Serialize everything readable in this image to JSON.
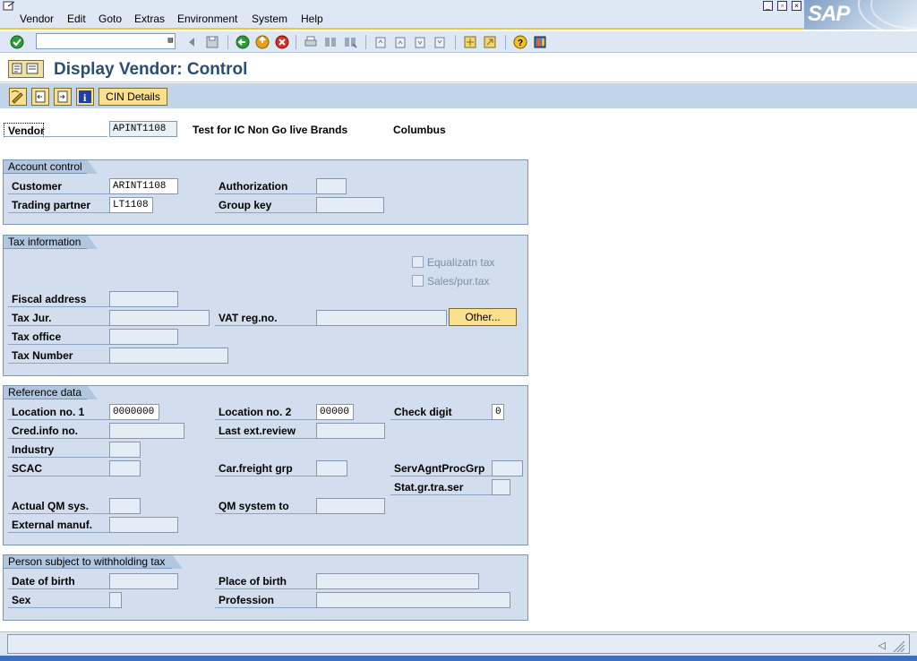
{
  "menubar": {
    "items": [
      "Vendor",
      "Edit",
      "Goto",
      "Extras",
      "Environment",
      "System",
      "Help"
    ],
    "logo_text": "SAP"
  },
  "toolbar": {
    "command_value": "",
    "icons": [
      "enter-icon",
      "back-icon",
      "exit-icon",
      "cancel-icon",
      "print-icon",
      "find-icon",
      "find-next-icon",
      "first-page-icon",
      "previous-page-icon",
      "next-page-icon",
      "last-page-icon",
      "create-session-icon",
      "shortcut-icon",
      "help-icon",
      "layout-icon"
    ]
  },
  "title": {
    "text": "Display Vendor: Control"
  },
  "app_toolbar": {
    "cin_label": "CIN Details"
  },
  "vendor": {
    "label": "Vendor",
    "value": "APINT1108",
    "name": "Test for IC Non Go live Brands",
    "city": "Columbus"
  },
  "account_control": {
    "title": "Account control",
    "customer_label": "Customer",
    "customer_value": "ARINT1108",
    "trading_partner_label": "Trading partner",
    "trading_partner_value": "LT1108",
    "authorization_label": "Authorization",
    "authorization_value": "",
    "group_key_label": "Group key",
    "group_key_value": ""
  },
  "tax_information": {
    "title": "Tax information",
    "equalization_label": "Equalizatn tax",
    "sales_purchase_label": "Sales/pur.tax",
    "fiscal_address_label": "Fiscal address",
    "tax_jur_label": "Tax Jur.",
    "vat_reg_label": "VAT reg.no.",
    "other_button_label": "Other...",
    "tax_office_label": "Tax office",
    "tax_number_label": "Tax Number"
  },
  "reference_data": {
    "title": "Reference data",
    "location1_label": "Location no. 1",
    "location1_value": "0000000",
    "location2_label": "Location no. 2",
    "location2_value": "00000",
    "check_digit_label": "Check digit",
    "check_digit_value": "0",
    "cred_info_label": "Cred.info no.",
    "last_ext_review_label": "Last ext.review",
    "industry_label": "Industry",
    "scac_label": "SCAC",
    "car_freight_label": "Car.freight grp",
    "serv_agnt_label": "ServAgntProcGrp",
    "stat_gr_label": "Stat.gr.tra.ser",
    "actual_qm_label": "Actual QM sys.",
    "qm_system_to_label": "QM system to",
    "external_manuf_label": "External manuf."
  },
  "withholding": {
    "title": "Person subject to withholding tax",
    "date_of_birth_label": "Date of birth",
    "place_of_birth_label": "Place of birth",
    "sex_label": "Sex",
    "profession_label": "Profession"
  },
  "colors": {
    "menubar": "#dde8f4",
    "group_background": "#d2deed",
    "button_yellow": "#fbe08e",
    "title_blue": "#2a4d78",
    "accent_orange": "#f1c24f"
  }
}
